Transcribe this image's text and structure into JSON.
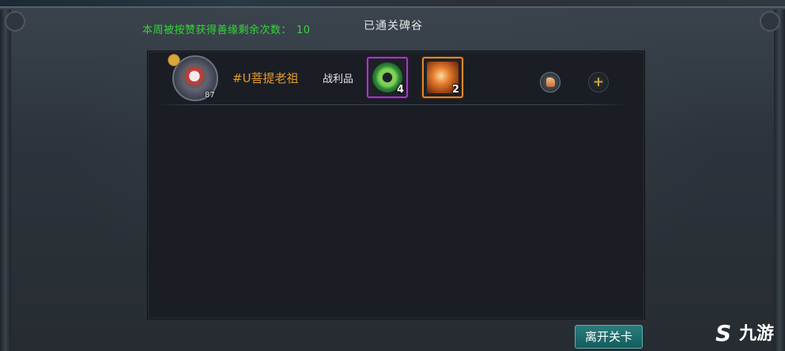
{
  "header": {
    "weekly_likes_label": "本周被按赞获得善缘剩余次数：",
    "weekly_likes_count": "10",
    "stage_title": "已通关碑谷"
  },
  "player_row": {
    "level": "87",
    "name": "#U菩提老祖",
    "loot_label": "战利品",
    "loot_items": [
      {
        "icon": "jade-disc-icon",
        "count": "4",
        "rarity_color": "#a23bc4"
      },
      {
        "icon": "fire-feather-icon",
        "count": "2",
        "rarity_color": "#e4842c"
      }
    ]
  },
  "footer": {
    "leave_button": "离开关卡"
  },
  "watermark": {
    "logo": "S",
    "text": "九游"
  }
}
